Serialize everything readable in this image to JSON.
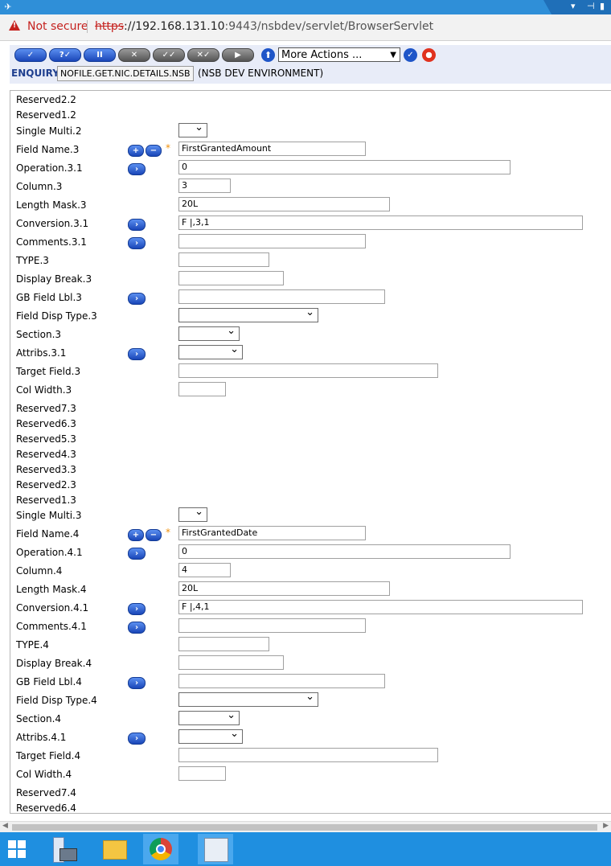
{
  "browser": {
    "not_secure": "Not secure",
    "url_scheme": "https",
    "url_rest_host": "://192.168.131.10",
    "url_rest_path": ":9443/nsbdev/servlet/BrowserServlet"
  },
  "toolbar": {
    "buttons": [
      "✓",
      "?✓",
      "II",
      "✕",
      "✓✓",
      "✕✓",
      "▶"
    ],
    "more_actions": "More Actions ..."
  },
  "header": {
    "enquiry_label": "ENQUIRY,",
    "enquiry_name": "NOFILE.GET.NIC.DETAILS.NSB",
    "environment": "(NSB DEV ENVIRONMENT)"
  },
  "rows": [
    {
      "label": "Reserved2.2"
    },
    {
      "label": "Reserved1.2"
    },
    {
      "label": "Single Multi.2"
    },
    {
      "label": "Field Name.3",
      "value": "FirstGrantedAmount"
    },
    {
      "label": "Operation.3.1",
      "value": "0"
    },
    {
      "label": "Column.3",
      "value": "3"
    },
    {
      "label": "Length Mask.3",
      "value": "20L"
    },
    {
      "label": "Conversion.3.1",
      "value": "F |,3,1"
    },
    {
      "label": "Comments.3.1",
      "value": ""
    },
    {
      "label": "TYPE.3",
      "value": ""
    },
    {
      "label": "Display Break.3",
      "value": ""
    },
    {
      "label": "GB Field Lbl.3",
      "value": ""
    },
    {
      "label": "Field Disp Type.3"
    },
    {
      "label": "Section.3"
    },
    {
      "label": "Attribs.3.1"
    },
    {
      "label": "Target Field.3",
      "value": ""
    },
    {
      "label": "Col Width.3",
      "value": ""
    },
    {
      "label": "Reserved7.3"
    },
    {
      "label": "Reserved6.3"
    },
    {
      "label": "Reserved5.3"
    },
    {
      "label": "Reserved4.3"
    },
    {
      "label": "Reserved3.3"
    },
    {
      "label": "Reserved2.3"
    },
    {
      "label": "Reserved1.3"
    },
    {
      "label": "Single Multi.3"
    },
    {
      "label": "Field Name.4",
      "value": "FirstGrantedDate"
    },
    {
      "label": "Operation.4.1",
      "value": "0"
    },
    {
      "label": "Column.4",
      "value": "4"
    },
    {
      "label": "Length Mask.4",
      "value": "20L"
    },
    {
      "label": "Conversion.4.1",
      "value": "F |,4,1"
    },
    {
      "label": "Comments.4.1",
      "value": ""
    },
    {
      "label": "TYPE.4",
      "value": ""
    },
    {
      "label": "Display Break.4",
      "value": ""
    },
    {
      "label": "GB Field Lbl.4",
      "value": ""
    },
    {
      "label": "Field Disp Type.4"
    },
    {
      "label": "Section.4"
    },
    {
      "label": "Attribs.4.1"
    },
    {
      "label": "Target Field.4",
      "value": ""
    },
    {
      "label": "Col Width.4",
      "value": ""
    },
    {
      "label": "Reserved7.4"
    },
    {
      "label": "Reserved6.4"
    }
  ]
}
